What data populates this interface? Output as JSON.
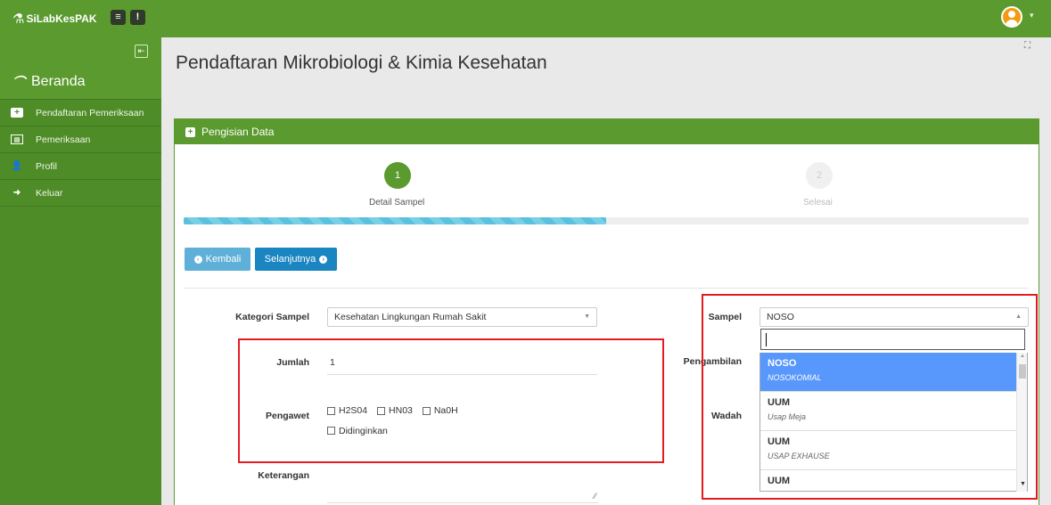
{
  "topbar": {
    "brand": "SiLabKesPAK",
    "menu_button": "≡",
    "info_button": "!"
  },
  "sidebar": {
    "home_label": "Beranda",
    "items": [
      {
        "label": "Pendaftaran Pemeriksaan",
        "icon": "plus-square-icon"
      },
      {
        "label": "Pemeriksaan",
        "icon": "list-icon"
      },
      {
        "label": "Profil",
        "icon": "user-icon"
      },
      {
        "label": "Keluar",
        "icon": "sign-out-icon"
      }
    ]
  },
  "page": {
    "title": "Pendaftaran Mikrobiologi & Kimia Kesehatan"
  },
  "panel": {
    "title": "Pengisian Data"
  },
  "wizard": {
    "steps": [
      {
        "number": "1",
        "label": "Detail Sampel"
      },
      {
        "number": "2",
        "label": "Selesai"
      }
    ],
    "progress": 0.5,
    "back_label": "Kembali",
    "next_label": "Selanjutnya"
  },
  "form": {
    "kategori_label": "Kategori Sampel",
    "kategori_value": "Kesehatan Lingkungan Rumah Sakit",
    "jumlah_label": "Jumlah",
    "jumlah_value": "1",
    "pengawet_label": "Pengawet",
    "pengawet_options": [
      "H2S04",
      "HN03",
      "Na0H",
      "Didinginkan"
    ],
    "keterangan_label": "Keterangan",
    "sampel_label": "Sampel",
    "sampel_value": "NOSO",
    "pengambilan_label": "Pengambilan",
    "wadah_label": "Wadah"
  },
  "dropdown": {
    "search_value": "",
    "options": [
      {
        "title": "NOSO",
        "subtitle": "NOSOKOMIAL",
        "selected": true
      },
      {
        "title": "UUM",
        "subtitle": "Usap Meja",
        "selected": false
      },
      {
        "title": "UUM",
        "subtitle": "USAP EXHAUSE",
        "selected": false
      },
      {
        "title": "UUM",
        "subtitle": "",
        "selected": false
      }
    ]
  },
  "colors": {
    "brand_green": "#5a9a2e",
    "sidebar_green": "#4e8c27",
    "highlight_red": "#e51b23",
    "selected_blue": "#5897fb",
    "next_button_blue": "#1a85c1"
  }
}
